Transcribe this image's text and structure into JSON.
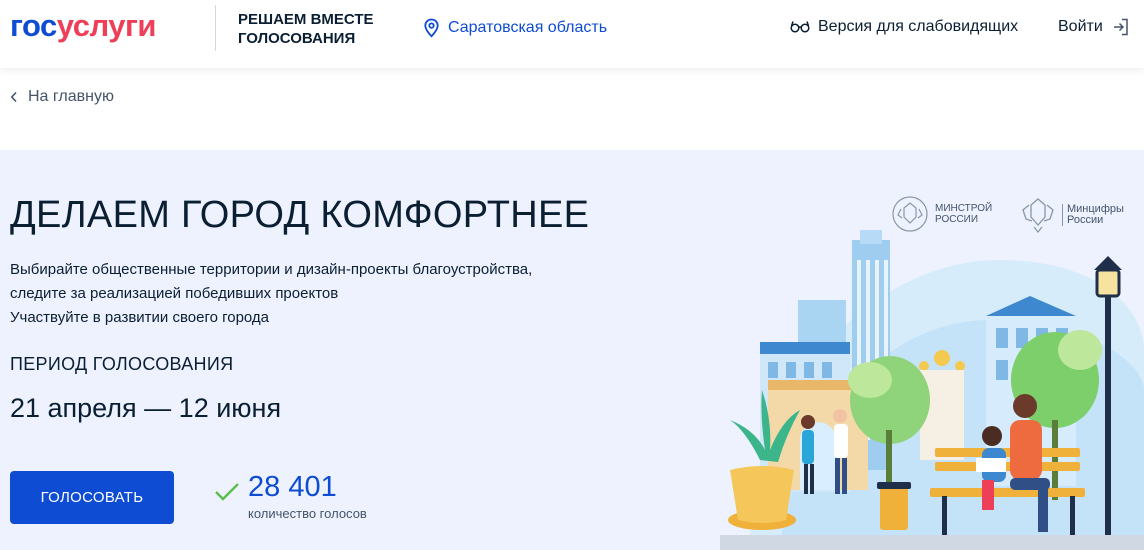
{
  "header": {
    "logo_part1": "гос",
    "logo_part2": "услуги",
    "project_title": "РЕШАЕМ ВМЕСТЕ ГОЛОСОВАНИЯ",
    "region": "Саратовская область",
    "accessibility": "Версия для слабовидящих",
    "login": "Войти"
  },
  "breadcrumb": {
    "back_label": "На главную"
  },
  "hero": {
    "title": "ДЕЛАЕМ ГОРОД КОМФОРТНЕЕ",
    "description": [
      "Выбирайте общественные территории и дизайн-проекты благоустройства,",
      "следите за реализацией победивших проектов",
      "Участвуйте в развитии своего города"
    ],
    "period_label": "ПЕРИОД ГОЛОСОВАНИЯ",
    "period": "21 апреля — 12 июня",
    "vote_button": "ГОЛОСОВАТЬ",
    "votes_count": "28 401",
    "votes_label": "количество голосов"
  },
  "ministries": [
    {
      "line1": "МИНСТРОЙ",
      "line2": "РОССИИ"
    },
    {
      "line1": "Минцифры",
      "line2": "России"
    }
  ],
  "icons": [
    "location-pin-icon",
    "glasses-icon",
    "login-arrow-icon",
    "chevron-left-icon",
    "check-icon",
    "emblem-icon"
  ],
  "colors": {
    "brand_blue": "#0d4cd3",
    "brand_red": "#ee3f58",
    "hero_bg": "#edf2fe",
    "check_green": "#5bbf4b"
  }
}
